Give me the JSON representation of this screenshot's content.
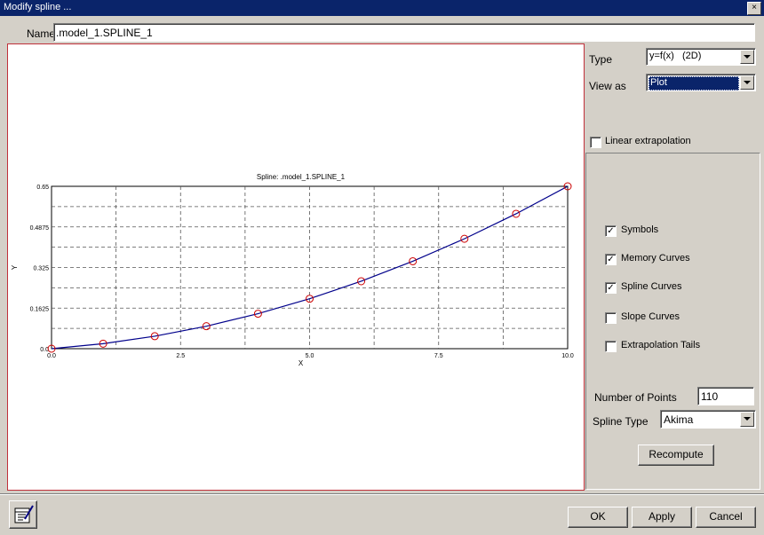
{
  "window": {
    "title": "Modify spline ...",
    "close_glyph": "×"
  },
  "name_field": {
    "label": "Name",
    "value": ".model_1.SPLINE_1"
  },
  "type_select": {
    "label": "Type",
    "value": "y=f(x)   (2D)"
  },
  "view_select": {
    "label": "View as",
    "value": "Plot"
  },
  "linear_extrapolation": {
    "label": "Linear extrapolation",
    "checked": false
  },
  "display_options": [
    {
      "label": "Symbols",
      "checked": true
    },
    {
      "label": "Memory Curves",
      "checked": true
    },
    {
      "label": "Spline Curves",
      "checked": true
    },
    {
      "label": "Slope Curves",
      "checked": false
    },
    {
      "label": "Extrapolation Tails",
      "checked": false
    }
  ],
  "num_points": {
    "label": "Number of Points",
    "value": "110"
  },
  "spline_type": {
    "label": "Spline Type",
    "value": "Akima"
  },
  "recompute_label": "Recompute",
  "footer": {
    "ok": "OK",
    "apply": "Apply",
    "cancel": "Cancel",
    "table_icon": "table-edit-icon"
  },
  "colors": {
    "title_bar": "#0a246a",
    "curve": "#00008b",
    "symbol": "#cc0000",
    "plot_border": "#c0303a"
  },
  "chart_data": {
    "type": "line",
    "title": "Spline: .model_1.SPLINE_1",
    "xlabel": "X",
    "ylabel": "Y",
    "xlim": [
      0.0,
      10.0
    ],
    "ylim": [
      0.0,
      0.65
    ],
    "x_ticks": [
      "0.0",
      "2.5",
      "5.0",
      "7.5",
      "10.0"
    ],
    "y_ticks": [
      "0.0",
      "0.1625",
      "0.325",
      "0.4875",
      "0.65"
    ],
    "grid": true,
    "series": [
      {
        "x": [
          0,
          1,
          2,
          3,
          4,
          5,
          6,
          7,
          8,
          9,
          10
        ],
        "y": [
          0.0,
          0.02,
          0.05,
          0.09,
          0.14,
          0.2,
          0.27,
          0.35,
          0.44,
          0.54,
          0.65
        ]
      }
    ]
  }
}
